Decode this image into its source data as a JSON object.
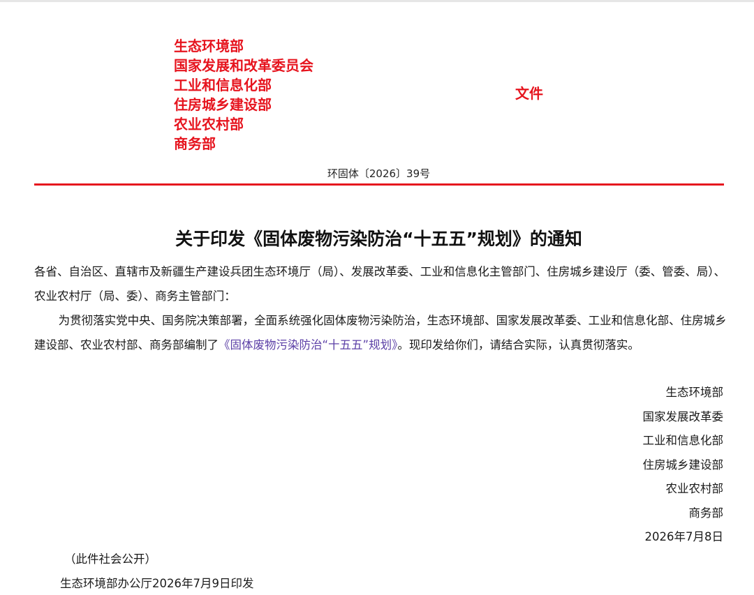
{
  "header": {
    "issuers": [
      "生态环境部",
      "国家发展和改革委员会",
      "工业和信息化部",
      "住房城乡建设部",
      "农业农村部",
      "商务部"
    ],
    "file_label": "文件",
    "doc_number": "环固体〔2026〕39号",
    "accent_color": "#e6141e"
  },
  "title": "关于印发《固体废物污染防治“十五五”规划》的通知",
  "body": {
    "addressee": "各省、自治区、直辖市及新疆生产建设兵团生态环境厅（局）、发展改革委、工业和信息化主管部门、住房城乡建设厅（委、管委、局）、农业农村厅（局、委）、商务主管部门：",
    "para_before": "为贯彻落实党中央、国务院决策部署，全面系统强化固体废物污染防治，生态环境部、国家发展改革委、工业和信息化部、住房城乡建设部、农业农村部、商务部编制了",
    "para_link": "《固体废物污染防治“十五五”规划》",
    "para_after": "。现印发给你们，请结合实际，认真贯彻落实。",
    "link_color": "#5b3fa6"
  },
  "signature": {
    "signers": [
      "生态环境部",
      "国家发展改革委",
      "工业和信息化部",
      "住房城乡建设部",
      "农业农村部",
      "商务部"
    ],
    "date": "2026年7月8日"
  },
  "footer": {
    "public_note": "（此件社会公开）",
    "print_line": "生态环境部办公厅2026年7月9日印发"
  }
}
